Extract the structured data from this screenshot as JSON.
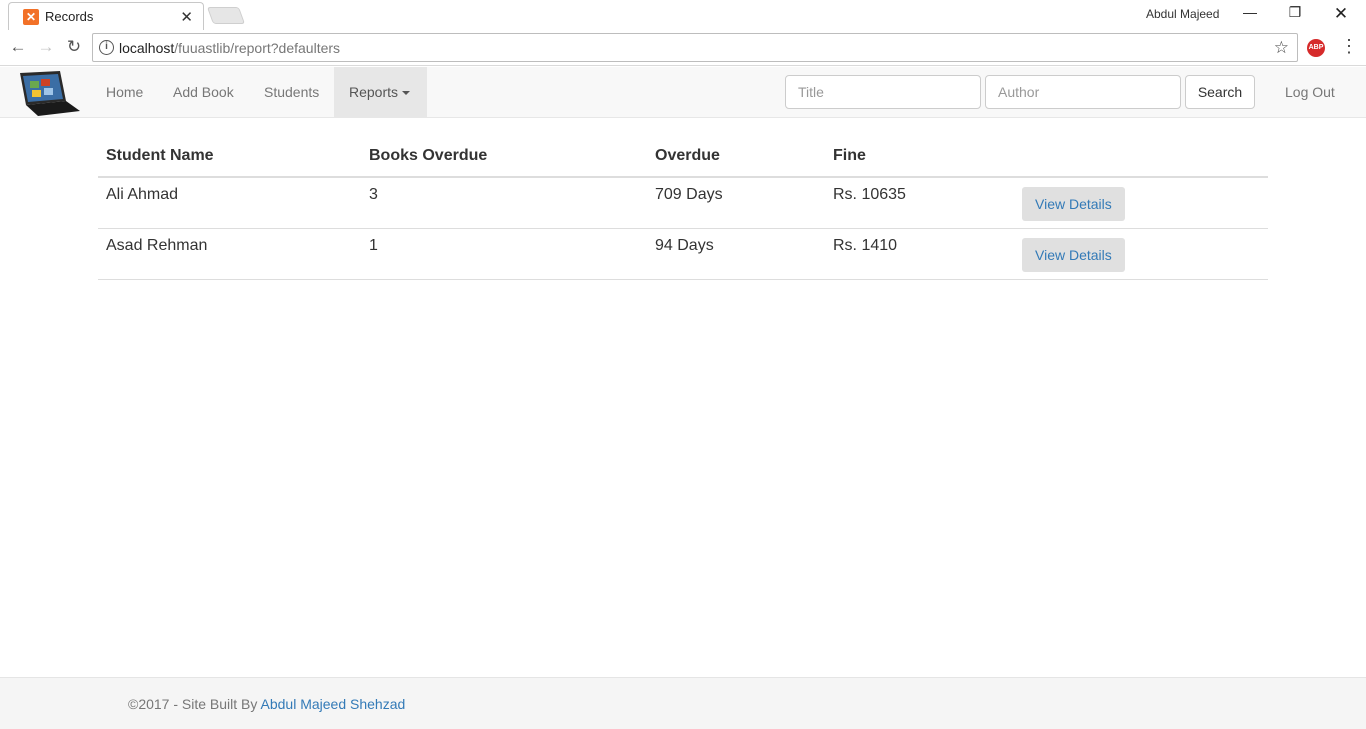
{
  "browser": {
    "tab_title": "Records",
    "tab_close": "✕",
    "profile_name": "Abdul Majeed",
    "url_host": "localhost",
    "url_path": "/fuuastlib/report?defaulters",
    "abp_label": "ABP"
  },
  "navbar": {
    "links": {
      "home": "Home",
      "add_book": "Add Book",
      "students": "Students",
      "reports": "Reports",
      "logout": "Log Out"
    },
    "search": {
      "title_placeholder": "Title",
      "author_placeholder": "Author",
      "button": "Search"
    }
  },
  "table": {
    "headers": {
      "student_name": "Student Name",
      "books_overdue": "Books Overdue",
      "overdue": "Overdue",
      "fine": "Fine"
    },
    "rows": [
      {
        "student_name": "Ali Ahmad",
        "books_overdue": "3",
        "overdue": "709 Days",
        "fine": "Rs. 10635",
        "action": "View Details"
      },
      {
        "student_name": "Asad Rehman",
        "books_overdue": "1",
        "overdue": "94 Days",
        "fine": "Rs. 1410",
        "action": "View Details"
      }
    ]
  },
  "footer": {
    "text": "©2017 - Site Built By ",
    "link": "Abdul Majeed Shehzad"
  },
  "icons": {
    "back": "arrow-left-icon",
    "forward": "arrow-right-icon",
    "reload": "reload-icon",
    "info": "info-icon",
    "star": "star-icon",
    "menu": "kebab-menu-icon"
  }
}
